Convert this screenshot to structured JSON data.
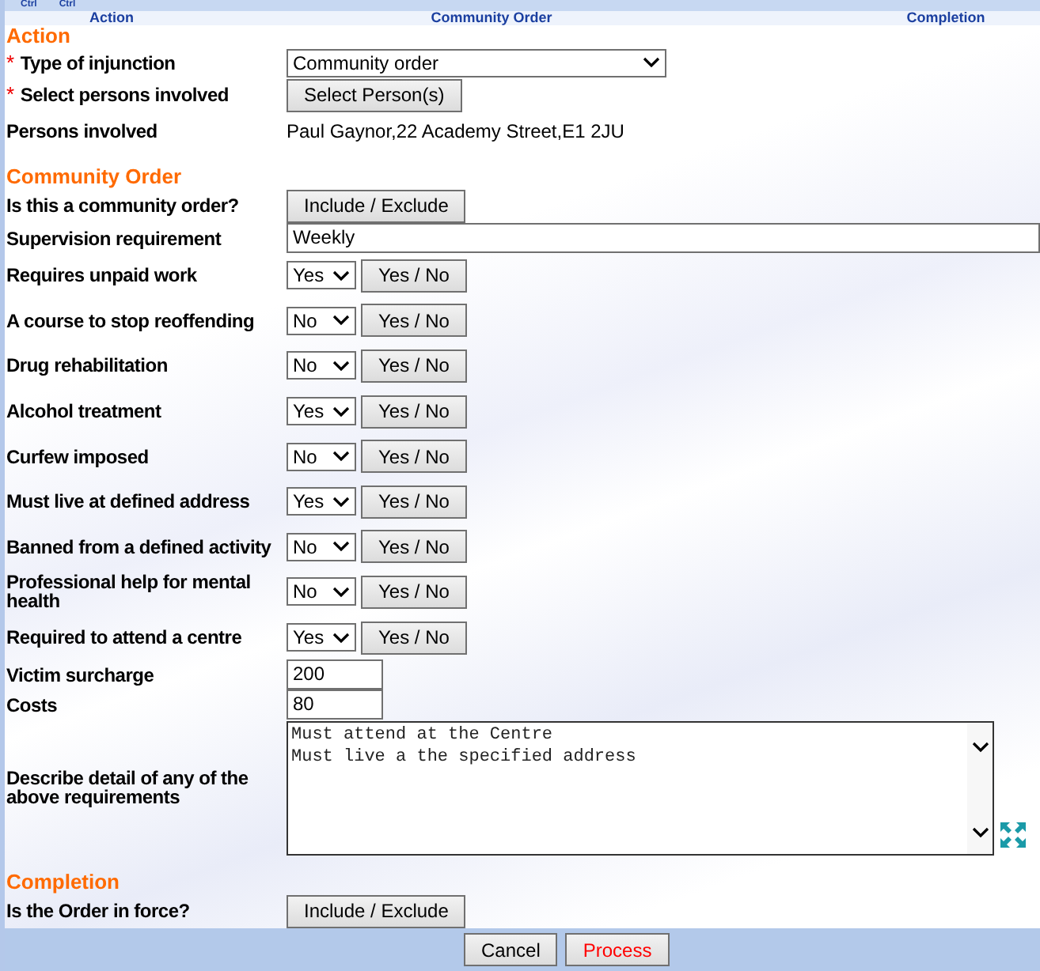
{
  "top_strip": [
    "Ctrl",
    "Ctrl"
  ],
  "column_headers": [
    "Action",
    "Community Order",
    "Completion"
  ],
  "sections": [
    {
      "title": "Action",
      "fields": [
        {
          "kind": "select",
          "marker": "*",
          "label": "Type of injunction",
          "required": true,
          "value": "Community order"
        },
        {
          "kind": "button",
          "marker": "*",
          "label": "Select persons involved",
          "required": true,
          "button": "Select Person(s)"
        },
        {
          "kind": "text",
          "label": "Persons involved",
          "required": false,
          "value": "Paul Gaynor,22 Academy Street,E1 2JU"
        }
      ]
    },
    {
      "title": "Community Order",
      "fields": [
        {
          "kind": "button",
          "label": "Is this a community order?",
          "required": false,
          "button": "Include / Exclude"
        },
        {
          "kind": "wideinput",
          "label": "Supervision requirement",
          "required": false,
          "value": "Weekly"
        },
        {
          "kind": "yesno",
          "label": "Requires unpaid work",
          "required": false,
          "value": "Yes",
          "button": "Yes / No"
        },
        {
          "kind": "yesno",
          "label": "A course to stop reoffending",
          "required": false,
          "value": "No",
          "button": "Yes / No"
        },
        {
          "kind": "yesno",
          "label": "Drug rehabilitation",
          "required": false,
          "value": "No",
          "button": "Yes / No"
        },
        {
          "kind": "yesno",
          "label": "Alcohol treatment",
          "required": false,
          "value": "Yes",
          "button": "Yes / No"
        },
        {
          "kind": "yesno",
          "label": "Curfew imposed",
          "required": false,
          "value": "No",
          "button": "Yes / No"
        },
        {
          "kind": "yesno",
          "label": "Must live at defined address",
          "required": false,
          "value": "Yes",
          "button": "Yes / No"
        },
        {
          "kind": "yesno",
          "label": "Banned from a defined activity",
          "required": false,
          "value": "No",
          "button": "Yes / No"
        },
        {
          "kind": "yesno",
          "label": "Professional help for mental health",
          "required": false,
          "value": "No",
          "button": "Yes / No"
        },
        {
          "kind": "yesno",
          "label": "Required to attend a centre",
          "required": false,
          "value": "Yes",
          "button": "Yes / No"
        },
        {
          "kind": "input",
          "label": "Victim surcharge",
          "required": false,
          "value": "200"
        },
        {
          "kind": "input",
          "label": "Costs",
          "required": false,
          "value": "80"
        },
        {
          "kind": "textarea",
          "label": "Describe detail of any of the above requirements",
          "required": false,
          "value": "Must attend at the Centre\nMust live a the specified address"
        }
      ]
    },
    {
      "title": "Completion",
      "fields": [
        {
          "kind": "button",
          "label": "Is the Order in force?",
          "required": false,
          "button": "Include / Exclude"
        }
      ]
    }
  ],
  "footer_buttons": [
    {
      "label": "Cancel",
      "kind": "normal"
    },
    {
      "label": "Process",
      "kind": "primary"
    }
  ]
}
